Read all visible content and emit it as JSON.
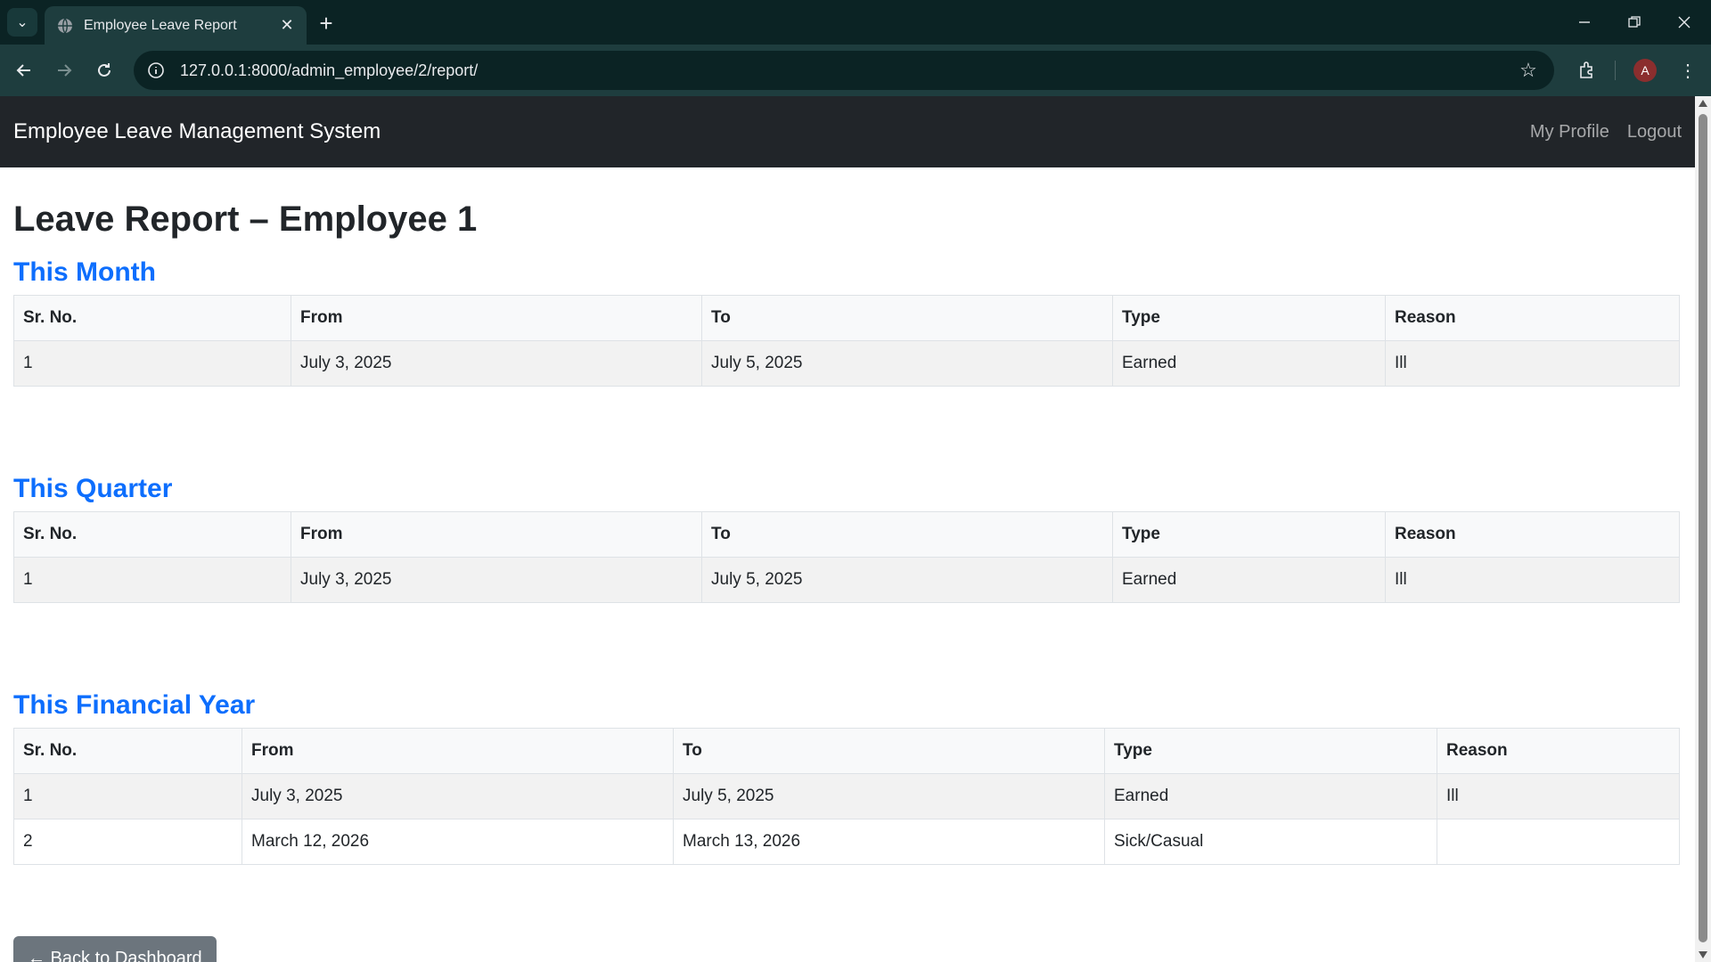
{
  "browser": {
    "tab_title": "Employee Leave Report",
    "url": "127.0.0.1:8000/admin_employee/2/report/",
    "profile_initial": "A"
  },
  "app": {
    "brand": "Employee Leave Management System",
    "nav": {
      "profile": "My Profile",
      "logout": "Logout"
    }
  },
  "page": {
    "title": "Leave Report – Employee 1",
    "back_button": "← Back to Dashboard"
  },
  "columns": [
    "Sr. No.",
    "From",
    "To",
    "Type",
    "Reason"
  ],
  "sections": [
    {
      "title": "This Month",
      "rows": [
        [
          "1",
          "July 3, 2025",
          "July 5, 2025",
          "Earned",
          "Ill"
        ]
      ]
    },
    {
      "title": "This Quarter",
      "rows": [
        [
          "1",
          "July 3, 2025",
          "July 5, 2025",
          "Earned",
          "Ill"
        ]
      ]
    },
    {
      "title": "This Financial Year",
      "rows": [
        [
          "1",
          "July 3, 2025",
          "July 5, 2025",
          "Earned",
          "Ill"
        ],
        [
          "2",
          "March 12, 2026",
          "March 13, 2026",
          "Sick/Casual",
          ""
        ]
      ]
    }
  ]
}
